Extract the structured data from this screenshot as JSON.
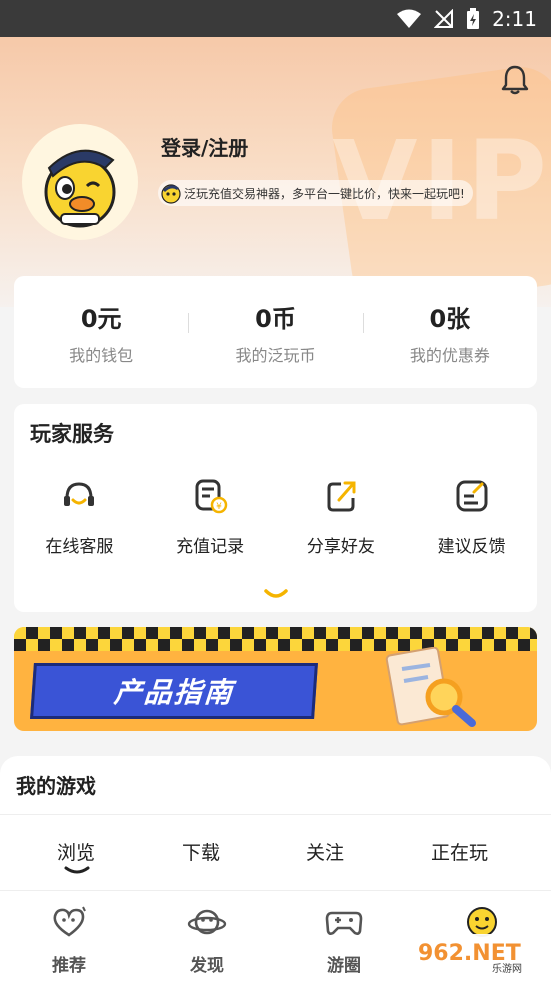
{
  "status_bar": {
    "time": "2:11"
  },
  "header": {
    "deco_text": "VIP",
    "login_label": "登录/注册",
    "slogan": "泛玩充值交易神器，多平台一键比价，快来一起玩吧!"
  },
  "stats": [
    {
      "value": "0元",
      "label": "我的钱包"
    },
    {
      "value": "0币",
      "label": "我的泛玩币"
    },
    {
      "value": "0张",
      "label": "我的优惠券"
    }
  ],
  "services": {
    "title": "玩家服务",
    "items": [
      {
        "label": "在线客服",
        "icon": "headset-icon"
      },
      {
        "label": "充值记录",
        "icon": "recharge-record-icon"
      },
      {
        "label": "分享好友",
        "icon": "share-icon"
      },
      {
        "label": "建议反馈",
        "icon": "feedback-icon"
      }
    ]
  },
  "banner": {
    "title": "产品指南"
  },
  "games": {
    "title": "我的游戏",
    "tabs": [
      "浏览",
      "下载",
      "关注",
      "正在玩"
    ],
    "active_tab": "浏览"
  },
  "bottom_nav": [
    {
      "label": "推荐",
      "icon": "heart-icon"
    },
    {
      "label": "发现",
      "icon": "planet-icon"
    },
    {
      "label": "游圈",
      "icon": "gamepad-icon"
    },
    {
      "label": "",
      "icon": "smiley-icon"
    }
  ],
  "watermark": {
    "brand": "962.NET",
    "sub": "乐游网"
  },
  "colors": {
    "accent": "#f5b400",
    "brand_blue": "#3a54d6"
  }
}
